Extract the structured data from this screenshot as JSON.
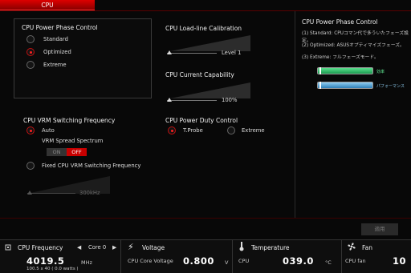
{
  "tab": {
    "label": "CPU"
  },
  "phase_panel": {
    "title": "CPU Power Phase Control",
    "options": [
      {
        "label": "Standard",
        "selected": false
      },
      {
        "label": "Optimized",
        "selected": true
      },
      {
        "label": "Extreme",
        "selected": false
      }
    ]
  },
  "loadline": {
    "title": "CPU Load-line Calibration",
    "value": "Level 1"
  },
  "current_cap": {
    "title": "CPU Current Capability",
    "value": "100%"
  },
  "duty": {
    "title": "CPU Power Duty Control",
    "options": [
      {
        "label": "T.Probe",
        "selected": true
      },
      {
        "label": "Extreme",
        "selected": false
      }
    ]
  },
  "vrm": {
    "title": "CPU VRM Switching Frequency",
    "auto_label": "Auto",
    "spread_label": "VRM Spread Spectrum",
    "toggle_on": "ON",
    "toggle_off": "OFF",
    "fixed_label": "Fixed CPU VRM Switching Frequency",
    "freq_value": "300kHz"
  },
  "info": {
    "title": "CPU Power Phase Control",
    "line1": "(1) Standard: CPUコマン代で多ういたフェーズ設定。",
    "line2": "(2) Optimized: ASUSオプティマイズフェーズ。",
    "line3": "(3) Extreme: フルフェーズモード。",
    "bar1_label": "効率",
    "bar2_label": "パフォーマンス"
  },
  "apply_label": "適用",
  "bottom": {
    "freq": {
      "title": "CPU Frequency",
      "core_label": "Core 0",
      "value": "4019.5",
      "unit": "MHz",
      "detail": "100.5  x  40   ( 0.0      watts )"
    },
    "voltage": {
      "title": "Voltage",
      "label": "CPU Core Voltage",
      "value": "0.800",
      "unit": "V"
    },
    "temp": {
      "title": "Temperature",
      "label": "CPU",
      "value": "039.0",
      "unit": "°C"
    },
    "fan": {
      "title": "Fan",
      "label": "CPU fan",
      "value": "10"
    }
  }
}
